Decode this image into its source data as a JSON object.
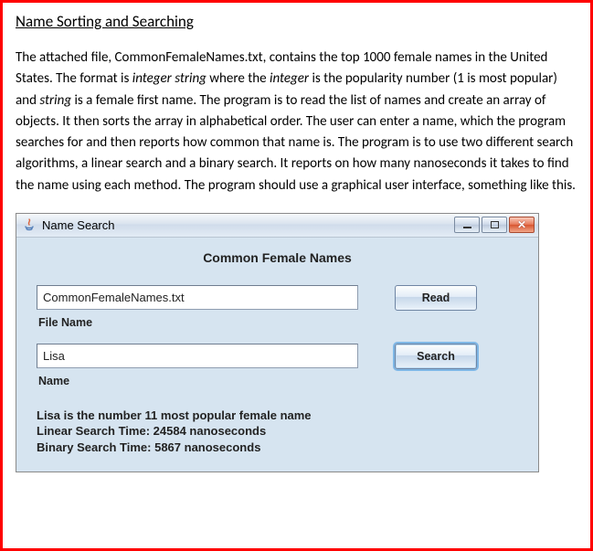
{
  "doc": {
    "heading": "Name Sorting and Searching",
    "p1a": "The attached file, CommonFemaleNames.txt, contains the top 1000 female names in the United States. The format is ",
    "p1b": "integer string",
    "p1c": " where the ",
    "p1d": "integer",
    "p1e": " is the popularity number (1 is most popular) and ",
    "p1f": "string",
    "p1g": " is a female first name. The program is to read the list of names and create an array of objects. It then sorts the array in alphabetical order. The user can enter a name, which the program searches for and then reports how common that name is. The program is to use two different search algorithms, a linear search and a binary search. It reports on how many nanoseconds it takes to find the name using each method. The program should use a graphical user interface, something like this."
  },
  "window": {
    "title": "Name Search",
    "heading": "Common Female Names",
    "file_input_value": "CommonFemaleNames.txt",
    "file_label": "File Name",
    "read_btn": "Read",
    "name_input_value": "Lisa",
    "name_label": "Name",
    "search_btn": "Search",
    "result_line1": "Lisa is the number 11 most popular female name",
    "result_line2": "Linear Search Time: 24584 nanoseconds",
    "result_line3": "Binary Search Time: 5867 nanoseconds"
  }
}
